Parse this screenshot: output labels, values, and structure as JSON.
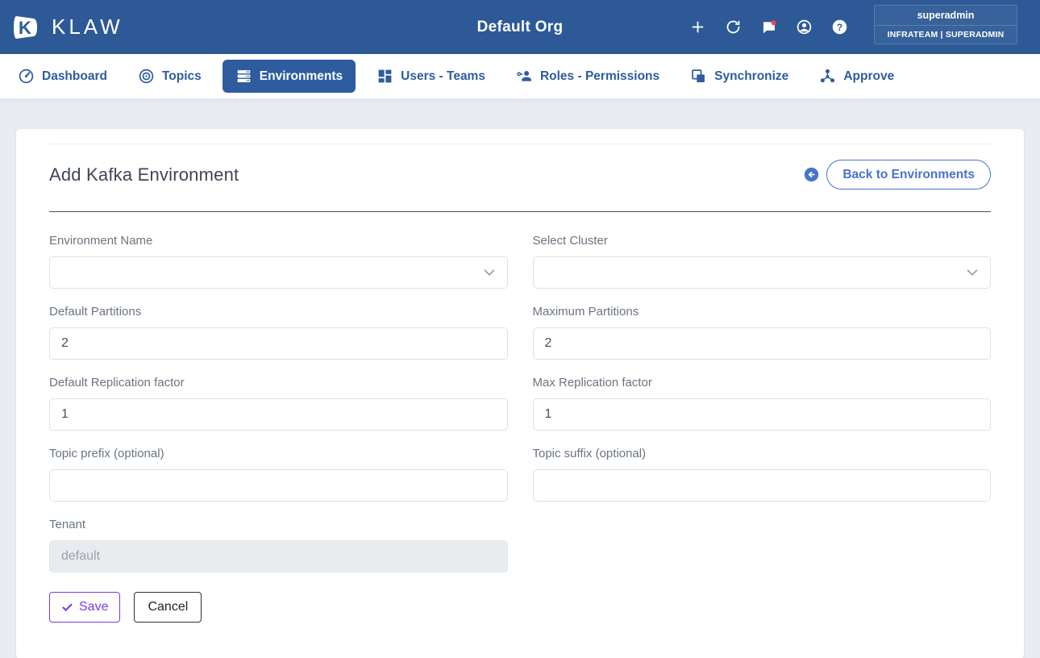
{
  "header": {
    "brand": "KLAW",
    "org_title": "Default Org",
    "user": {
      "name": "superadmin",
      "team_role": "INFRATEAM | SUPERADMIN"
    }
  },
  "nav": {
    "items": [
      {
        "label": "Dashboard",
        "icon": "gauge-icon",
        "active": false
      },
      {
        "label": "Topics",
        "icon": "target-icon",
        "active": false
      },
      {
        "label": "Environments",
        "icon": "server-stack-icon",
        "active": true
      },
      {
        "label": "Users - Teams",
        "icon": "grid-icon",
        "active": false
      },
      {
        "label": "Roles - Permissions",
        "icon": "person-key-icon",
        "active": false
      },
      {
        "label": "Synchronize",
        "icon": "copy-squares-icon",
        "active": false
      },
      {
        "label": "Approve",
        "icon": "hub-icon",
        "active": false
      }
    ]
  },
  "page": {
    "title": "Add Kafka Environment",
    "back_button_label": "Back to Environments",
    "form": {
      "environment_name": {
        "label": "Environment Name",
        "value": ""
      },
      "select_cluster": {
        "label": "Select Cluster",
        "value": ""
      },
      "default_partitions": {
        "label": "Default Partitions",
        "value": "2"
      },
      "maximum_partitions": {
        "label": "Maximum Partitions",
        "value": "2"
      },
      "default_replication_factor": {
        "label": "Default Replication factor",
        "value": "1"
      },
      "max_replication_factor": {
        "label": "Max Replication factor",
        "value": "1"
      },
      "topic_prefix": {
        "label": "Topic prefix (optional)",
        "value": ""
      },
      "topic_suffix": {
        "label": "Topic suffix (optional)",
        "value": ""
      },
      "tenant": {
        "label": "Tenant",
        "placeholder": "default",
        "value": ""
      }
    },
    "actions": {
      "save_label": "Save",
      "cancel_label": "Cancel"
    }
  },
  "colors": {
    "header_bg": "#2d5a96",
    "nav_link": "#2e5c9e",
    "nav_active_bg": "#2e5c9e",
    "back_button_blue": "#4873cb",
    "save_purple": "#7c3aed",
    "notification_badge": "#f0435a",
    "title_text": "#3e4653",
    "label_text": "#6b7480",
    "page_bg": "#e9edf2"
  }
}
